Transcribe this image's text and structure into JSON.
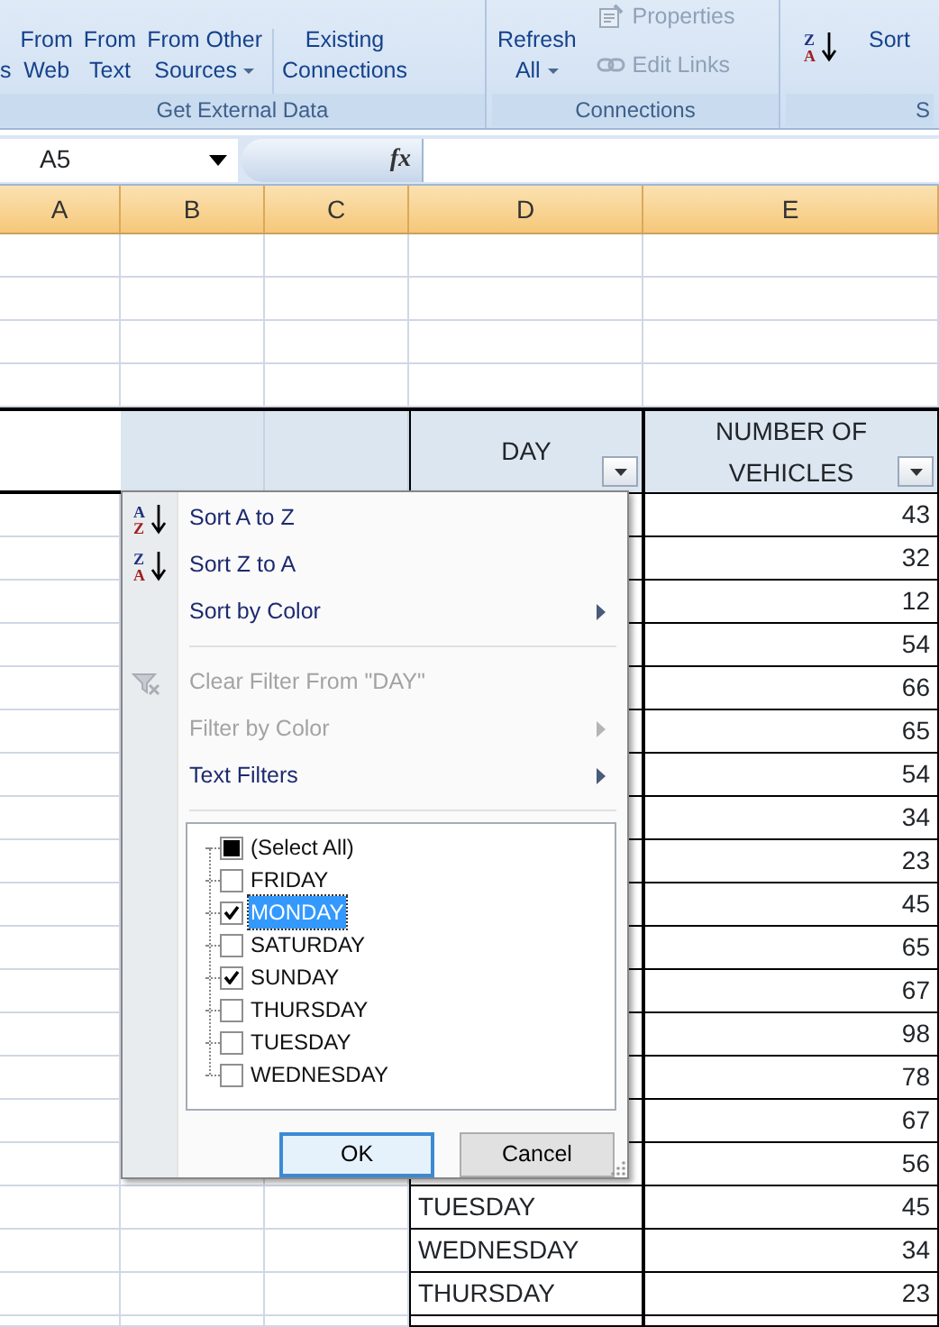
{
  "ribbon": {
    "groups": [
      {
        "label": "Get External Data",
        "items": [
          {
            "kind": "large",
            "lines": [
              "s"
            ],
            "dropdown": false
          },
          {
            "kind": "large",
            "lines": [
              "From",
              "Web"
            ],
            "dropdown": false
          },
          {
            "kind": "large",
            "lines": [
              "From",
              "Text"
            ],
            "dropdown": false
          },
          {
            "kind": "large",
            "lines": [
              "From Other",
              "Sources"
            ],
            "dropdown": true
          },
          {
            "kind": "divider"
          },
          {
            "kind": "large",
            "lines": [
              "Existing",
              "Connections"
            ],
            "dropdown": false
          }
        ]
      },
      {
        "label": "Connections",
        "items": [
          {
            "kind": "large",
            "lines": [
              "Refresh",
              "All"
            ],
            "dropdown": true
          },
          {
            "kind": "small",
            "buttons": [
              {
                "label": "Properties",
                "disabled": true
              },
              {
                "label": "Edit Links",
                "disabled": true
              }
            ]
          }
        ]
      },
      {
        "label": "S",
        "items": [
          {
            "kind": "sort_icon",
            "letters": [
              "Z",
              "A"
            ]
          },
          {
            "kind": "large",
            "lines": [
              "Sort"
            ],
            "dropdown": false
          }
        ]
      }
    ]
  },
  "formula_bar": {
    "name_box": "A5",
    "function_button": "fx"
  },
  "column_headers": [
    "A",
    "B",
    "C",
    "D",
    "E"
  ],
  "table": {
    "columns": [
      {
        "label": "DAY",
        "filter": true
      },
      {
        "label": "NUMBER OF VEHICLES",
        "filter": true
      }
    ],
    "rows": [
      {
        "vehicles": "43"
      },
      {
        "vehicles": "32"
      },
      {
        "vehicles": "12"
      },
      {
        "vehicles": "54"
      },
      {
        "vehicles": "66"
      },
      {
        "vehicles": "65"
      },
      {
        "vehicles": "54"
      },
      {
        "vehicles": "34"
      },
      {
        "vehicles": "23"
      },
      {
        "vehicles": "45"
      },
      {
        "vehicles": "65"
      },
      {
        "vehicles": "67"
      },
      {
        "vehicles": "98"
      },
      {
        "vehicles": "78"
      },
      {
        "vehicles": "67"
      },
      {
        "vehicles": "56"
      },
      {
        "day": "TUESDAY",
        "vehicles": "45"
      },
      {
        "day": "WEDNESDAY",
        "vehicles": "34"
      },
      {
        "day": "THURSDAY",
        "vehicles": "23"
      }
    ]
  },
  "filter_menu": {
    "items": [
      {
        "kind": "sort",
        "label": "Sort A to Z",
        "icon_letters": [
          "A",
          "Z"
        ],
        "disabled": false,
        "submenu": false
      },
      {
        "kind": "sort",
        "label": "Sort Z to A",
        "icon_letters": [
          "Z",
          "A"
        ],
        "disabled": false,
        "submenu": false
      },
      {
        "kind": "plain",
        "label": "Sort by Color",
        "disabled": false,
        "submenu": true
      },
      {
        "kind": "separator"
      },
      {
        "kind": "clear_filter",
        "label": "Clear Filter From \"DAY\"",
        "disabled": true,
        "submenu": false
      },
      {
        "kind": "plain",
        "label": "Filter by Color",
        "disabled": true,
        "submenu": true
      },
      {
        "kind": "plain",
        "label": "Text Filters",
        "disabled": false,
        "submenu": true
      },
      {
        "kind": "separator"
      }
    ],
    "values": [
      {
        "label": "(Select All)",
        "checked": true,
        "partial": true,
        "selected": false
      },
      {
        "label": "FRIDAY",
        "checked": false,
        "partial": false,
        "selected": false
      },
      {
        "label": "MONDAY",
        "checked": true,
        "partial": false,
        "selected": true
      },
      {
        "label": "SATURDAY",
        "checked": false,
        "partial": false,
        "selected": false
      },
      {
        "label": "SUNDAY",
        "checked": true,
        "partial": false,
        "selected": false
      },
      {
        "label": "THURSDAY",
        "checked": false,
        "partial": false,
        "selected": false
      },
      {
        "label": "TUESDAY",
        "checked": false,
        "partial": false,
        "selected": false
      },
      {
        "label": "WEDNESDAY",
        "checked": false,
        "partial": false,
        "selected": false
      }
    ],
    "buttons": [
      {
        "label": "OK",
        "default": true
      },
      {
        "label": "Cancel",
        "default": false
      }
    ]
  }
}
